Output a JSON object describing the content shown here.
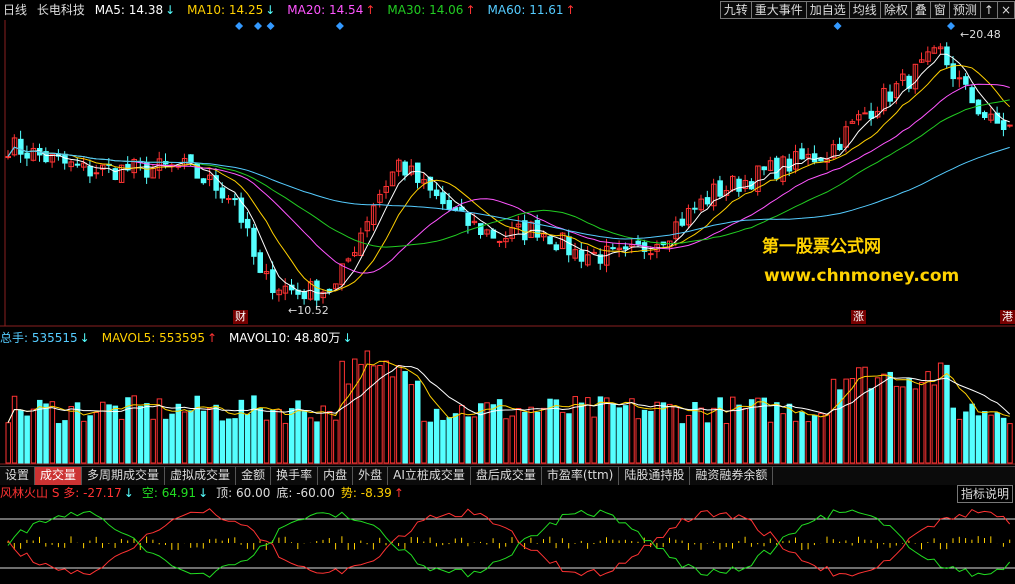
{
  "header": {
    "period": "日线",
    "stock_name": "长电科技",
    "ma": [
      {
        "label": "MA5: 14.38",
        "arrow": "↓",
        "color": "#ffffff"
      },
      {
        "label": "MA10: 14.25",
        "arrow": "↓",
        "color": "#ffd000"
      },
      {
        "label": "MA20: 14.54",
        "arrow": "↑",
        "color": "#ff55ff"
      },
      {
        "label": "MA30: 14.06",
        "arrow": "↑",
        "color": "#22cc22"
      },
      {
        "label": "MA60: 11.61",
        "arrow": "↑",
        "color": "#55ccff"
      }
    ]
  },
  "toolbar": [
    "九转",
    "重大事件",
    "加自选",
    "均线",
    "除权",
    "叠",
    "窗",
    "预测",
    "↑",
    "×"
  ],
  "price_labels": {
    "high": "20.48",
    "low": "10.52"
  },
  "event_tags": [
    "财",
    "涨",
    "港"
  ],
  "watermark": {
    "line1": "第一股票公式网",
    "line2": "www.chnmoney.com"
  },
  "volume_header": [
    {
      "label": "总手: 535515",
      "arrow": "↓",
      "color": "#55ccff"
    },
    {
      "label": "MAVOL5: 553595",
      "arrow": "↑",
      "color": "#ffd000"
    },
    {
      "label": "MAVOL10: 48.80万",
      "arrow": "↓",
      "color": "#ffffff"
    }
  ],
  "tabs": [
    "设置",
    "成交量",
    "多周期成交量",
    "虚拟成交量",
    "金额",
    "换手率",
    "内盘",
    "外盘",
    "AI立桩成交量",
    "盘后成交量",
    "市盈率(ttm)",
    "陆股通持股",
    "融资融券余额"
  ],
  "active_tab": "成交量",
  "indicator_header": [
    {
      "label": "风林火山 S 多: -27.17",
      "arrow": "↓",
      "color": "#ff3333"
    },
    {
      "label": "空: 64.91",
      "arrow": "↓",
      "color": "#22dd22"
    },
    {
      "label": "顶: 60.00",
      "arrow": "",
      "color": "#dddddd"
    },
    {
      "label": "底: -60.00",
      "arrow": "",
      "color": "#dddddd"
    },
    {
      "label": "势: -8.39",
      "arrow": "↑",
      "color": "#ffd000"
    }
  ],
  "indicator_help": "指标说明",
  "colors": {
    "up": "#ff3333",
    "down": "#55ffff",
    "ma5": "#ffffff",
    "ma10": "#ffd000",
    "ma20": "#ff55ff",
    "ma30": "#22cc22",
    "ma60": "#55ccff"
  },
  "chart_data": {
    "type": "candlestick",
    "series": [
      {
        "name": "MA5",
        "color": "#ffffff"
      },
      {
        "name": "MA10",
        "color": "#ffd000"
      },
      {
        "name": "MA20",
        "color": "#ff55ff"
      },
      {
        "name": "MA30",
        "color": "#22cc22"
      },
      {
        "name": "MA60",
        "color": "#55ccff"
      }
    ],
    "annotations": [
      {
        "text": "20.48",
        "kind": "high"
      },
      {
        "text": "10.52",
        "kind": "low"
      }
    ]
  }
}
